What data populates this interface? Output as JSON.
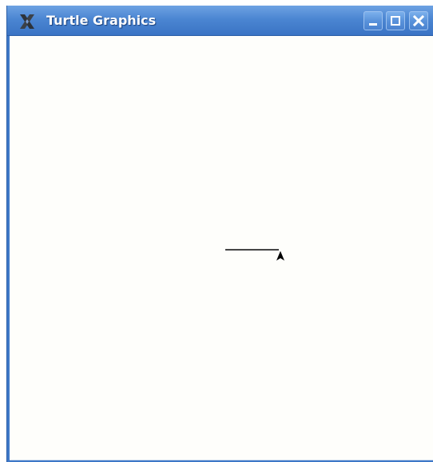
{
  "window": {
    "title": "Turtle Graphics",
    "icon": "x-logo-icon",
    "buttons": {
      "minimize": "minimize-icon",
      "maximize": "maximize-icon",
      "close": "close-icon"
    }
  },
  "canvas": {
    "background": "#fefefb",
    "pen_color": "#000000",
    "turtle_icon": "turtle-cursor-icon"
  },
  "colors": {
    "titlebar": "#4b86d2",
    "title_text": "#ffffff"
  }
}
